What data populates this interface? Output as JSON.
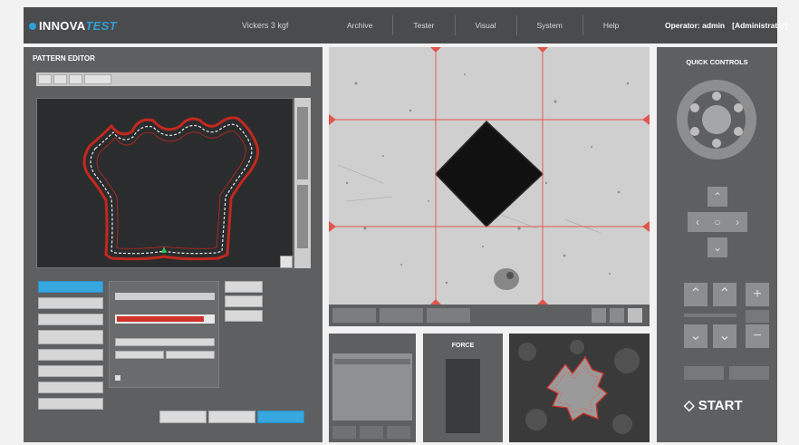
{
  "header": {
    "logo_main": "INNOVA",
    "logo_accent": "TEST",
    "method": "Vickers 3 kgf",
    "nav": [
      "Archive",
      "Tester",
      "Visual",
      "System",
      "Help"
    ],
    "operator": "Operator: admin",
    "role": "[Administrator]"
  },
  "pattern_editor": {
    "title": "PATTERN EDITOR"
  },
  "force_panel": {
    "title": "FORCE"
  },
  "quick_controls": {
    "title": "QUICK CONTROLS",
    "start_label": "START"
  },
  "colors": {
    "brand_blue": "#2ea0d8",
    "accent_red": "#d0332a",
    "panel_gray": "#5e5f61",
    "header_gray": "#4a4b4d"
  },
  "icons": [
    "logo-dot-icon",
    "joystick-icon",
    "arrow-up-icon",
    "arrow-down-icon",
    "arrow-left-icon",
    "arrow-right-icon",
    "home-icon",
    "double-up-icon",
    "double-down-icon",
    "plus-icon",
    "minus-icon",
    "start-icon"
  ]
}
